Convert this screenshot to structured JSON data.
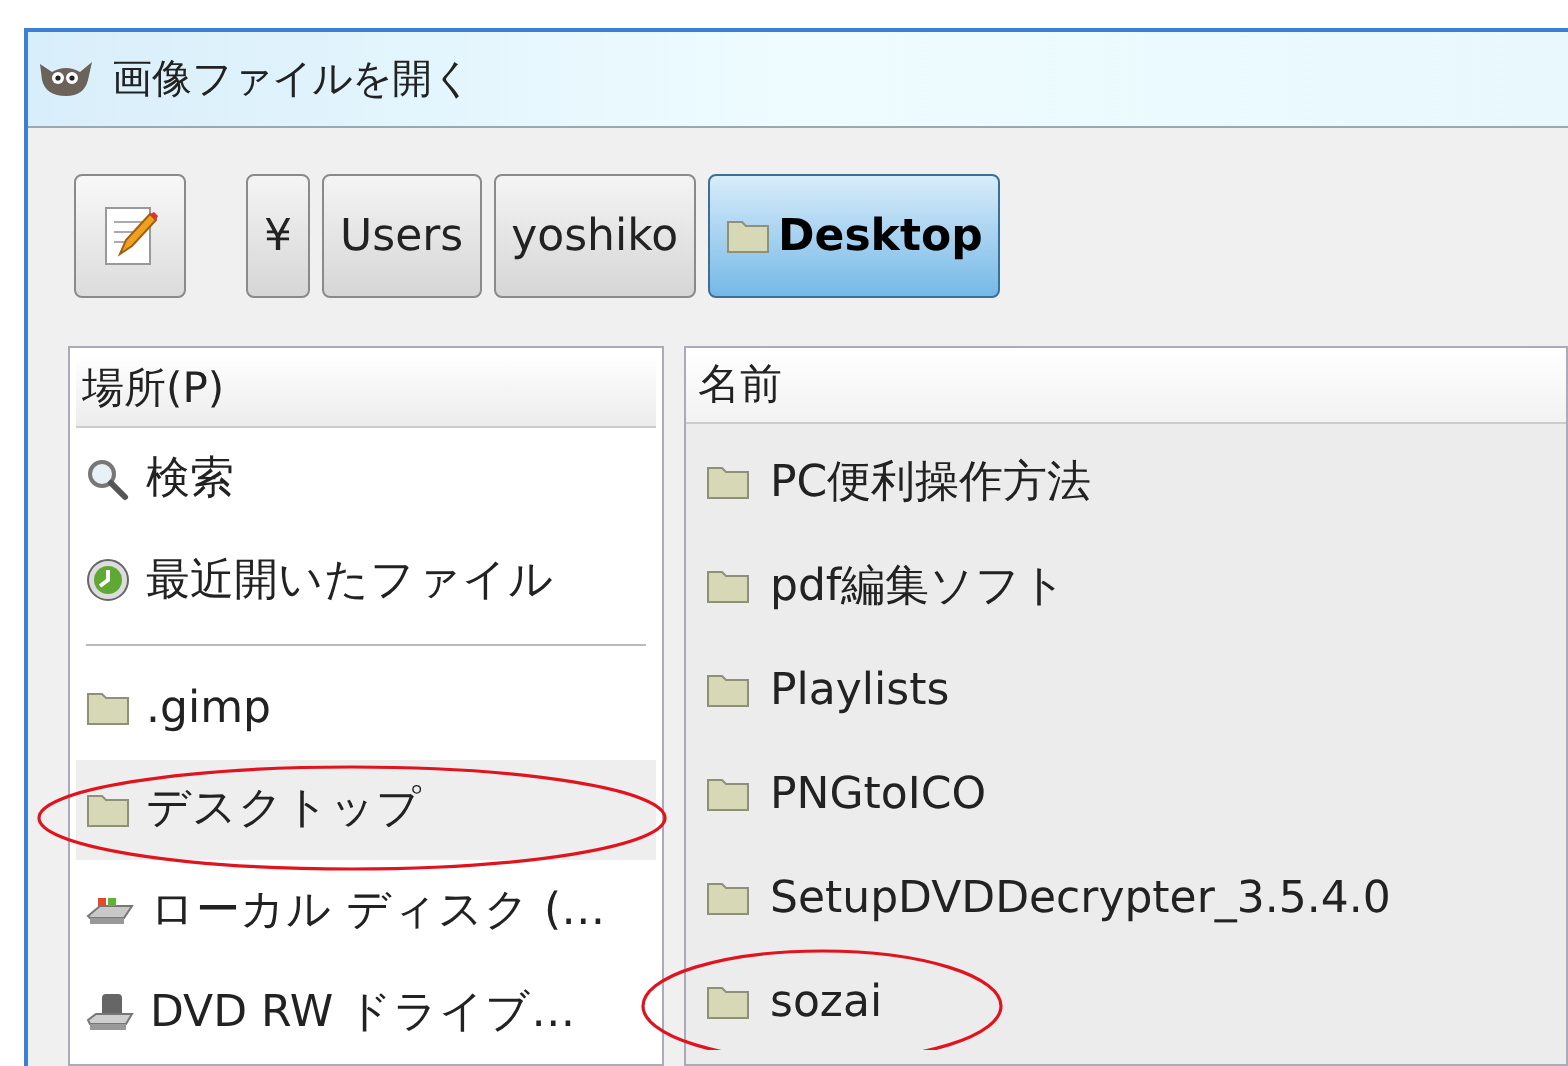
{
  "window": {
    "title": "画像ファイルを開く"
  },
  "path_bar": {
    "edit_button": true,
    "segments": [
      {
        "label": "¥",
        "kind": "text",
        "selected": false
      },
      {
        "label": "Users",
        "kind": "text",
        "selected": false
      },
      {
        "label": "yoshiko",
        "kind": "text",
        "selected": false
      },
      {
        "label": "Desktop",
        "kind": "folder",
        "selected": true
      }
    ]
  },
  "places": {
    "header": "場所(P)",
    "groups": [
      {
        "items": [
          {
            "label": "検索",
            "kind": "search",
            "selected": false,
            "circled": false
          },
          {
            "label": "最近開いたファイル",
            "kind": "recent",
            "selected": false,
            "circled": false
          }
        ]
      },
      {
        "items": [
          {
            "label": ".gimp",
            "kind": "folder",
            "selected": false,
            "circled": false
          },
          {
            "label": "デスクトップ",
            "kind": "folder",
            "selected": true,
            "circled": true
          },
          {
            "label": "ローカル ディスク (…",
            "kind": "drive",
            "selected": false,
            "circled": false
          },
          {
            "label": "DVD RW ドライブ…",
            "kind": "dvd",
            "selected": false,
            "circled": false
          }
        ]
      }
    ]
  },
  "files": {
    "columns": [
      "名前"
    ],
    "rows": [
      {
        "name": "PC便利操作方法",
        "circled": false
      },
      {
        "name": "pdf編集ソフト",
        "circled": false
      },
      {
        "name": "Playlists",
        "circled": false
      },
      {
        "name": "PNGtoICO",
        "circled": false
      },
      {
        "name": "SetupDVDDecrypter_3.5.4.0",
        "circled": false
      },
      {
        "name": "sozai",
        "circled": true
      }
    ]
  }
}
